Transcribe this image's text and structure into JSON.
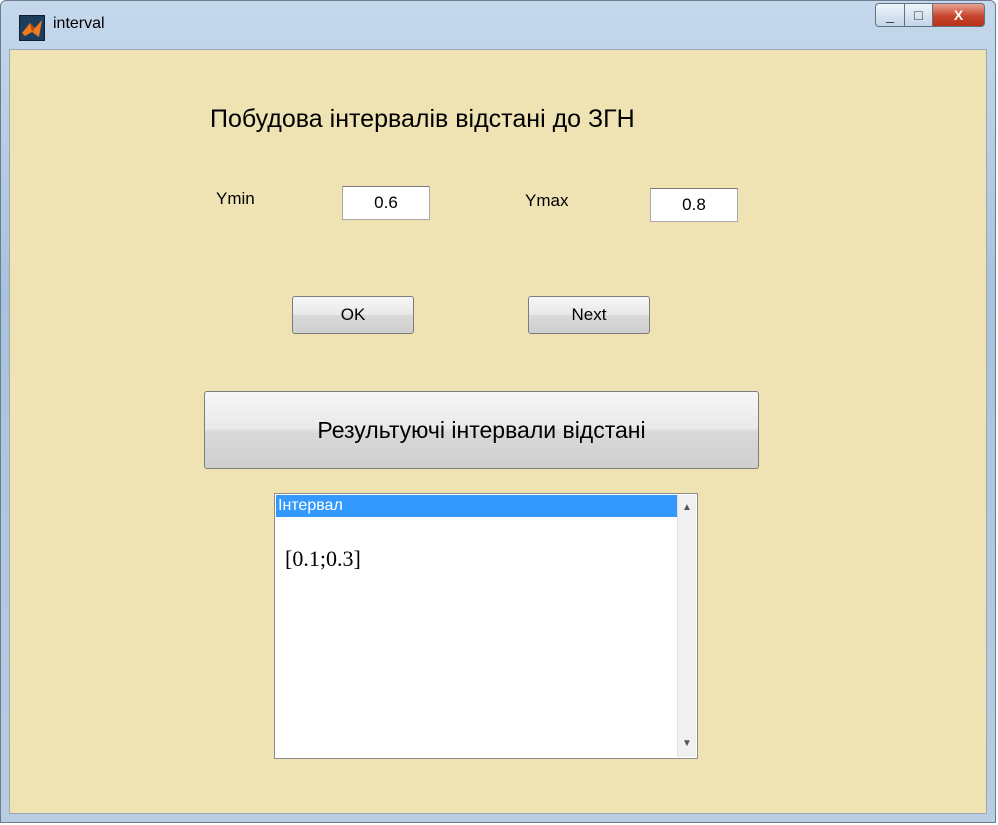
{
  "window": {
    "title": "interval",
    "icon": "matlab-icon",
    "controls": {
      "minimize": "_",
      "maximize": "□",
      "close": "X"
    }
  },
  "form": {
    "heading": "Побудова інтервалів відстані до ЗГН",
    "ymin_label": "Ymin",
    "ymin_value": "0.6",
    "ymax_label": "Ymax",
    "ymax_value": "0.8",
    "ok_button": "OK",
    "next_button": "Next",
    "results_button": "Результуючі інтервали відстані"
  },
  "listbox": {
    "selected_item": "Інтервал",
    "items": [
      "[0.1;0.3]"
    ],
    "scroll_up": "▲",
    "scroll_down": "▼"
  },
  "colors": {
    "client_background": "#efe3b3",
    "selection": "#3399ff",
    "close_button": "#c7452e"
  }
}
